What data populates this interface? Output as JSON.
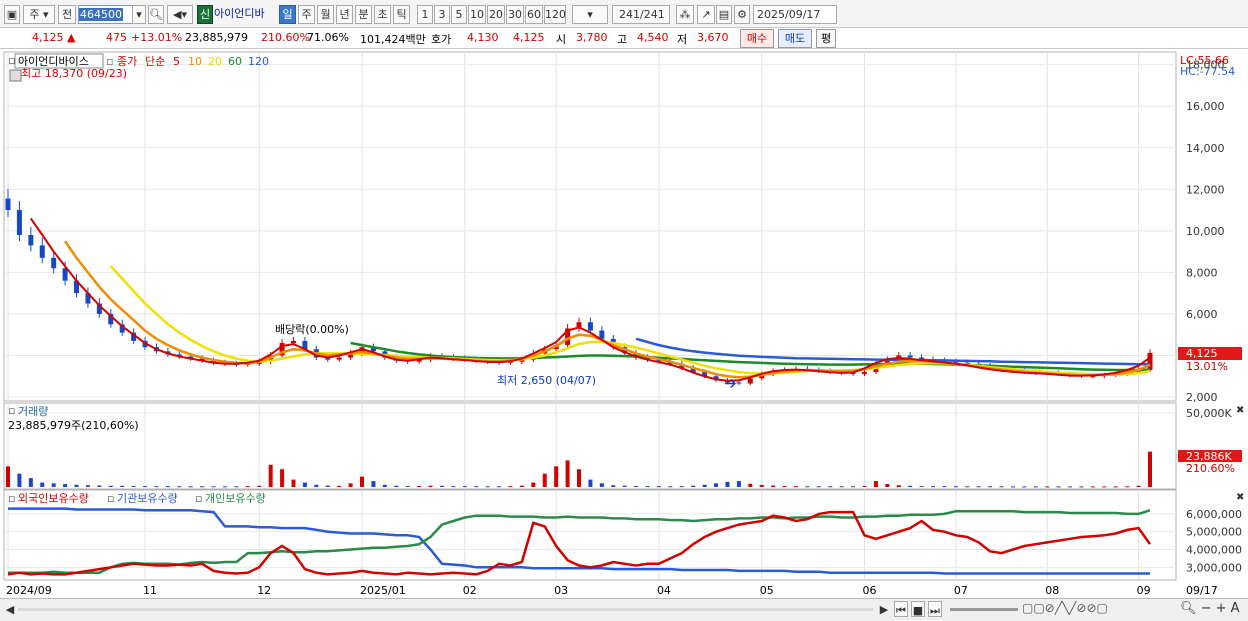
{
  "toolbar": {
    "market": "주",
    "prev": "전",
    "code": "464500",
    "credit_badge": "신",
    "stock_name": "아이언디바",
    "periods": [
      "일",
      "주",
      "월",
      "년",
      "분",
      "초",
      "틱"
    ],
    "active_period": "일",
    "minutes": [
      "1",
      "3",
      "5",
      "10",
      "20",
      "30",
      "60",
      "120"
    ],
    "count": "241",
    "total": "/241",
    "date": "2025/09/17"
  },
  "quote": {
    "price": "4,125 ▲",
    "change": "475",
    "change_pct": "+13.01%",
    "volume": "23,885,979",
    "vol_ratio": "210.60%",
    "turnover": "71.06%",
    "amount": "101,424백만",
    "hoga_label": "호가",
    "ask": "4,130",
    "bid": "4,125",
    "open_label": "시",
    "open": "3,780",
    "high_label": "고",
    "high": "4,540",
    "low_label": "저",
    "low": "3,670",
    "buy_label": "매수",
    "sell_label": "매도",
    "avg_label": "평"
  },
  "chart_data": [
    {
      "type": "line",
      "title": "아이언디바이스",
      "legend_price": "종가",
      "legend_ma_label": "단순",
      "ma_periods": [
        "5",
        "10",
        "20",
        "60",
        "120"
      ],
      "colors": {
        "up": "#d40000",
        "down": "#1848c8",
        "ma5": "#d40000",
        "ma10": "#f08c00",
        "ma20": "#f0e000",
        "ma60": "#1a8a2a",
        "ma120": "#2a5ad8"
      },
      "high_annotation": "최고 18,370 (09/23)",
      "low_annotation": "최저 2,650 (04/07)",
      "dividend_annotation": "배당락(0.00%)",
      "lc": "LC:55.66",
      "hc": "HC:-77.54",
      "yticks": [
        "2,000",
        "4,000",
        "6,000",
        "8,000",
        "10,000",
        "12,000",
        "14,000",
        "16,000",
        "18,000"
      ],
      "ylim": [
        2000,
        18370
      ],
      "last_price": "4,125",
      "last_change": "13.01%",
      "xlabels": [
        "2024/09",
        "11",
        "12",
        "2025/01",
        "02",
        "03",
        "04",
        "05",
        "06",
        "07",
        "08",
        "09",
        "09/17"
      ],
      "close": [
        11000,
        9800,
        9300,
        8700,
        8200,
        7600,
        7000,
        6500,
        6000,
        5500,
        5100,
        4700,
        4400,
        4200,
        4050,
        3950,
        3850,
        3750,
        3650,
        3600,
        3550,
        3600,
        3700,
        4000,
        4600,
        4700,
        4300,
        3900,
        3800,
        3900,
        4100,
        4400,
        4200,
        3900,
        3750,
        3700,
        3800,
        3950,
        3900,
        3850,
        3800,
        3750,
        3700,
        3650,
        3700,
        3800,
        4100,
        4300,
        4500,
        5300,
        5600,
        5200,
        4800,
        4400,
        4100,
        3900,
        3800,
        3700,
        3600,
        3400,
        3200,
        3000,
        2800,
        2700,
        2650,
        2900,
        3100,
        3250,
        3300,
        3350,
        3300,
        3250,
        3200,
        3150,
        3100,
        3200,
        3600,
        3800,
        4000,
        3900,
        3800,
        3750,
        3700,
        3650,
        3600,
        3500,
        3400,
        3300,
        3250,
        3200,
        3150,
        3150,
        3100,
        3050,
        3000,
        3000,
        3050,
        3100,
        3200,
        3300,
        4125
      ],
      "ma5": [
        null,
        null,
        10600,
        9800,
        9000,
        8300,
        7600,
        7000,
        6400,
        5900,
        5400,
        5000,
        4600,
        4300,
        4100,
        3950,
        3850,
        3750,
        3650,
        3600,
        3600,
        3650,
        3750,
        4050,
        4450,
        4550,
        4300,
        4000,
        3900,
        4000,
        4150,
        4300,
        4150,
        3950,
        3800,
        3750,
        3820,
        3900,
        3870,
        3820,
        3780,
        3730,
        3690,
        3680,
        3720,
        3850,
        4100,
        4350,
        4650,
        5200,
        5350,
        5100,
        4750,
        4400,
        4150,
        3950,
        3800,
        3680,
        3560,
        3380,
        3180,
        2990,
        2850,
        2780,
        2800,
        2950,
        3120,
        3240,
        3300,
        3320,
        3290,
        3240,
        3190,
        3160,
        3180,
        3380,
        3640,
        3820,
        3880,
        3840,
        3770,
        3720,
        3660,
        3600,
        3520,
        3420,
        3330,
        3260,
        3210,
        3170,
        3140,
        3110,
        3070,
        3030,
        3020,
        3040,
        3090,
        3160,
        3300,
        3500,
        3900
      ],
      "ma10": [
        null,
        null,
        null,
        null,
        null,
        9500,
        8700,
        8000,
        7300,
        6700,
        6200,
        5700,
        5200,
        4800,
        4500,
        4250,
        4050,
        3900,
        3780,
        3700,
        3650,
        3620,
        3700,
        3900,
        4150,
        4300,
        4250,
        4100,
        4000,
        4050,
        4100,
        4150,
        4100,
        4000,
        3900,
        3850,
        3850,
        3860,
        3850,
        3820,
        3790,
        3750,
        3720,
        3720,
        3760,
        3850,
        4000,
        4200,
        4450,
        4800,
        5000,
        4950,
        4750,
        4500,
        4300,
        4100,
        3950,
        3820,
        3700,
        3550,
        3400,
        3250,
        3100,
        3000,
        2950,
        2980,
        3060,
        3150,
        3230,
        3280,
        3300,
        3280,
        3250,
        3230,
        3250,
        3350,
        3480,
        3600,
        3700,
        3740,
        3730,
        3700,
        3650,
        3590,
        3520,
        3450,
        3380,
        3320,
        3260,
        3210,
        3170,
        3140,
        3100,
        3070,
        3050,
        3050,
        3070,
        3100,
        3180,
        3300,
        3550
      ],
      "ma20": [
        null,
        null,
        null,
        null,
        null,
        null,
        null,
        null,
        null,
        8300,
        7700,
        7100,
        6500,
        6000,
        5500,
        5100,
        4750,
        4450,
        4200,
        4000,
        3850,
        3750,
        3700,
        3750,
        3850,
        3950,
        4050,
        4100,
        4100,
        4100,
        4100,
        4080,
        4050,
        4020,
        3980,
        3950,
        3920,
        3900,
        3880,
        3860,
        3830,
        3800,
        3780,
        3770,
        3780,
        3820,
        3900,
        4000,
        4150,
        4350,
        4550,
        4650,
        4650,
        4600,
        4500,
        4380,
        4250,
        4100,
        3950,
        3800,
        3650,
        3500,
        3380,
        3280,
        3200,
        3150,
        3130,
        3140,
        3170,
        3210,
        3250,
        3270,
        3280,
        3280,
        3300,
        3340,
        3400,
        3470,
        3540,
        3590,
        3620,
        3630,
        3620,
        3590,
        3550,
        3500,
        3440,
        3390,
        3340,
        3290,
        3250,
        3210,
        3170,
        3140,
        3110,
        3090,
        3080,
        3080,
        3100,
        3150,
        3250
      ],
      "ma60": [
        null,
        null,
        null,
        null,
        null,
        null,
        null,
        null,
        null,
        null,
        null,
        null,
        null,
        null,
        null,
        null,
        null,
        null,
        null,
        null,
        null,
        null,
        null,
        null,
        null,
        null,
        null,
        null,
        null,
        null,
        4600,
        4500,
        4400,
        4300,
        4200,
        4120,
        4050,
        4000,
        3950,
        3920,
        3900,
        3880,
        3870,
        3860,
        3860,
        3870,
        3880,
        3900,
        3920,
        3950,
        3980,
        4000,
        4000,
        3990,
        3970,
        3950,
        3920,
        3890,
        3860,
        3830,
        3800,
        3770,
        3740,
        3710,
        3680,
        3660,
        3640,
        3620,
        3600,
        3590,
        3580,
        3570,
        3560,
        3560,
        3560,
        3570,
        3580,
        3590,
        3600,
        3600,
        3600,
        3590,
        3580,
        3560,
        3540,
        3520,
        3500,
        3480,
        3460,
        3440,
        3420,
        3400,
        3380,
        3360,
        3340,
        3320,
        3310,
        3300,
        3300,
        3300,
        3320
      ],
      "ma120": [
        null,
        null,
        null,
        null,
        null,
        null,
        null,
        null,
        null,
        null,
        null,
        null,
        null,
        null,
        null,
        null,
        null,
        null,
        null,
        null,
        null,
        null,
        null,
        null,
        null,
        null,
        null,
        null,
        null,
        null,
        null,
        null,
        null,
        null,
        null,
        null,
        null,
        null,
        null,
        null,
        null,
        null,
        null,
        null,
        null,
        null,
        null,
        null,
        null,
        null,
        null,
        null,
        null,
        null,
        null,
        4800,
        4650,
        4500,
        4380,
        4280,
        4200,
        4140,
        4080,
        4030,
        3990,
        3960,
        3930,
        3910,
        3890,
        3870,
        3860,
        3850,
        3840,
        3830,
        3820,
        3810,
        3800,
        3790,
        3790,
        3780,
        3780,
        3770,
        3760,
        3750,
        3740,
        3730,
        3720,
        3700,
        3690,
        3680,
        3670,
        3660,
        3650,
        3640,
        3630,
        3620,
        3610,
        3600,
        3590,
        3580,
        3580
      ]
    },
    {
      "type": "bar",
      "title": "거래량",
      "subtitle": "23,885,979주(210,60%)",
      "yticks": [
        "50,000K"
      ],
      "ylim": [
        0,
        50000
      ],
      "last_value": "23,886K",
      "last_change": "210.60%",
      "values": [
        14000,
        9000,
        6000,
        3000,
        2500,
        2000,
        1500,
        1200,
        1000,
        800,
        800,
        700,
        600,
        600,
        600,
        500,
        500,
        500,
        500,
        500,
        500,
        600,
        800,
        15000,
        12000,
        5000,
        3000,
        1500,
        1000,
        800,
        2500,
        7000,
        4000,
        1500,
        900,
        700,
        700,
        900,
        800,
        600,
        600,
        600,
        500,
        500,
        600,
        900,
        3000,
        9000,
        14000,
        18000,
        12000,
        5000,
        2500,
        1200,
        900,
        700,
        600,
        600,
        500,
        600,
        900,
        1500,
        2500,
        3500,
        4000,
        2200,
        1400,
        1000,
        700,
        600,
        500,
        500,
        500,
        500,
        500,
        700,
        4000,
        2000,
        1200,
        800,
        700,
        600,
        600,
        500,
        500,
        500,
        500,
        500,
        400,
        400,
        400,
        400,
        400,
        400,
        400,
        400,
        400,
        400,
        500,
        800,
        23886
      ]
    },
    {
      "type": "line",
      "series_labels": [
        "외국인보유수량",
        "기관보유수량",
        "개인보유수량"
      ],
      "colors": {
        "foreign": "#d40000",
        "inst": "#2a5ad8",
        "indiv": "#2a8a4a"
      },
      "yticks": [
        "3,000,000",
        "4,000,000",
        "5,000,000",
        "6,000,000"
      ],
      "ylim": [
        2400000,
        6500000
      ],
      "foreign": [
        2600000,
        2700000,
        2600000,
        2650000,
        2600000,
        2600000,
        2700000,
        2800000,
        2900000,
        3000000,
        3100000,
        3200000,
        3150000,
        3100000,
        3100000,
        3150000,
        3100000,
        3200000,
        2800000,
        2700000,
        2650000,
        2700000,
        3000000,
        3800000,
        4200000,
        3800000,
        2900000,
        2700000,
        2600000,
        2650000,
        2700000,
        2800000,
        2700000,
        2650000,
        2600000,
        2700000,
        2650000,
        2600000,
        2650000,
        2700000,
        2650000,
        2600000,
        2800000,
        3200000,
        3100000,
        3300000,
        5500000,
        5300000,
        4200000,
        3400000,
        3100000,
        3000000,
        3100000,
        3300000,
        3200000,
        3100000,
        3200000,
        3200000,
        3500000,
        3800000,
        4300000,
        4700000,
        5000000,
        5200000,
        5400000,
        5500000,
        5600000,
        5900000,
        5800000,
        5600000,
        5700000,
        6000000,
        6100000,
        6100000,
        6100000,
        4800000,
        4600000,
        4800000,
        5000000,
        5200000,
        5600000,
        5100000,
        5000000,
        4800000,
        4700000,
        4400000,
        3900000,
        3800000,
        4000000,
        4200000,
        4300000,
        4400000,
        4500000,
        4600000,
        4700000,
        4750000,
        4800000,
        4900000,
        5100000,
        5200000,
        4300000
      ],
      "inst": [
        6300000,
        6300000,
        6300000,
        6300000,
        6300000,
        6300000,
        6250000,
        6250000,
        6250000,
        6250000,
        6250000,
        6250000,
        6200000,
        6200000,
        6200000,
        6200000,
        6200000,
        6150000,
        6100000,
        5300000,
        5300000,
        5300000,
        5250000,
        5250000,
        5200000,
        5200000,
        5200000,
        5100000,
        5000000,
        4950000,
        4900000,
        4900000,
        4900000,
        4850000,
        4800000,
        4800000,
        4700000,
        4000000,
        3200000,
        3150000,
        3100000,
        3000000,
        3000000,
        3000000,
        3000000,
        3000000,
        2950000,
        2950000,
        2950000,
        2950000,
        2950000,
        2950000,
        2950000,
        2900000,
        2900000,
        2900000,
        2900000,
        2900000,
        2900000,
        2850000,
        2850000,
        2850000,
        2850000,
        2850000,
        2800000,
        2800000,
        2800000,
        2800000,
        2800000,
        2750000,
        2750000,
        2750000,
        2700000,
        2700000,
        2700000,
        2700000,
        2700000,
        2700000,
        2700000,
        2700000,
        2700000,
        2700000,
        2650000,
        2650000,
        2650000,
        2650000,
        2650000,
        2650000,
        2650000,
        2650000,
        2650000,
        2650000,
        2650000,
        2650000,
        2650000,
        2650000,
        2650000,
        2650000,
        2650000,
        2650000,
        2650000
      ],
      "indiv": [
        2700000,
        2700000,
        2700000,
        2700000,
        2750000,
        2700000,
        2700000,
        2700000,
        2700000,
        3000000,
        3200000,
        3250000,
        3200000,
        3200000,
        3200000,
        3150000,
        3250000,
        3300000,
        3250000,
        3300000,
        3300000,
        3800000,
        3800000,
        3850000,
        3900000,
        3850000,
        3850000,
        3900000,
        3900000,
        3950000,
        4000000,
        4050000,
        4100000,
        4100000,
        4150000,
        4200000,
        4300000,
        4700000,
        5400000,
        5600000,
        5800000,
        5900000,
        5900000,
        5900000,
        5850000,
        5850000,
        5850000,
        5800000,
        5800000,
        5850000,
        5800000,
        5800000,
        5800000,
        5750000,
        5750000,
        5700000,
        5700000,
        5700000,
        5650000,
        5650000,
        5600000,
        5650000,
        5700000,
        5700000,
        5750000,
        5750000,
        5800000,
        5800000,
        5750000,
        5800000,
        5800000,
        5850000,
        5850000,
        5800000,
        5800000,
        5850000,
        5850000,
        5900000,
        5900000,
        5950000,
        5950000,
        5950000,
        6000000,
        6150000,
        6150000,
        6150000,
        6150000,
        6150000,
        6150000,
        6100000,
        6100000,
        6100000,
        6100000,
        6050000,
        6050000,
        6050000,
        6050000,
        6050000,
        6000000,
        6000000,
        6200000
      ]
    }
  ]
}
